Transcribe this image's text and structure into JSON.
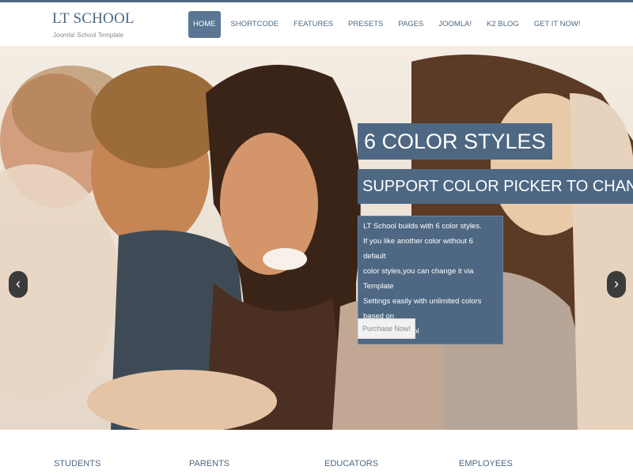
{
  "brand": {
    "title": "LT SCHOOL",
    "tagline": "Joomla! School Template"
  },
  "nav": [
    "HOME",
    "SHORTCODE",
    "FEATURES",
    "PRESETS",
    "PAGES",
    "JOOMLA!",
    "K2 BLOG",
    "GET IT NOW!"
  ],
  "slide": {
    "title": "6 COLOR STYLES",
    "subtitle": "SUPPORT COLOR PICKER TO CHANGE",
    "desc_lines": [
      "LT School builds with 6 color styles.",
      "If you like another color without 6 default",
      "color styles,you can change it via Template",
      "Settings easily with unlimited colors based on",
      "Color picker Tool"
    ],
    "button": "Purchase Now!",
    "prev_icon": "‹",
    "next_icon": "›"
  },
  "features": [
    "STUDENTS",
    "PARENTS",
    "EDUCATORS",
    "EMPLOYEES"
  ],
  "colors": {
    "accent": "#4e6883",
    "text": "#4d6882"
  }
}
